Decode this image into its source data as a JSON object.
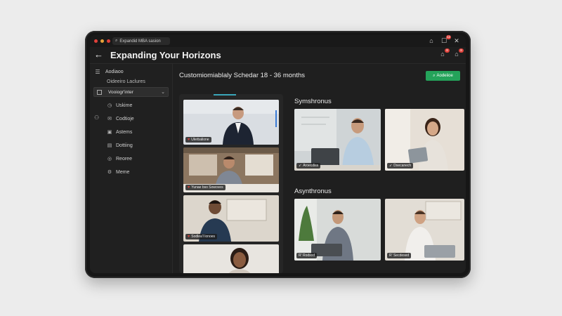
{
  "window": {
    "url_text": "Expandid MBA sasion",
    "dot_colors": [
      "#e0413a",
      "#e8a33a",
      "#e0413a"
    ],
    "badge_count": "12"
  },
  "header": {
    "title": "Expanding Your Horizons",
    "badge_left": "8",
    "badge_right": "8"
  },
  "sidebar": {
    "heading": "Aodiaoo",
    "subheading": "Oideeiro Laclures",
    "select_value": "Vooiogr'inter",
    "side_label": "Codtaoje",
    "items": [
      {
        "icon": "clock-icon",
        "label": "Uskime"
      },
      {
        "icon": "mail-icon",
        "label": "Codtioje"
      },
      {
        "icon": "chart-icon",
        "label": "Astems"
      },
      {
        "icon": "document-icon",
        "label": "Dottiing"
      },
      {
        "icon": "globe-icon",
        "label": "Reoree"
      },
      {
        "icon": "gear-icon",
        "label": "Meme"
      }
    ]
  },
  "content": {
    "title": "Customiomiablaly Schedar 18 - 36 months",
    "action_button": "Aodeiioe",
    "left_tiles": [
      {
        "label": "Ulerbalione"
      },
      {
        "label": "Yunae bso Sowoves"
      },
      {
        "label": "Sodlea'l lonoes"
      },
      {
        "label": ""
      }
    ],
    "sync_title": "Symshronus",
    "sync_tiles": [
      {
        "label": "Aroecdiss"
      },
      {
        "label": "Dsecanech"
      }
    ],
    "async_title": "Asynthronus",
    "async_tiles": [
      {
        "label": "R' Rodsod"
      },
      {
        "label": "R' Secdesed"
      }
    ]
  }
}
